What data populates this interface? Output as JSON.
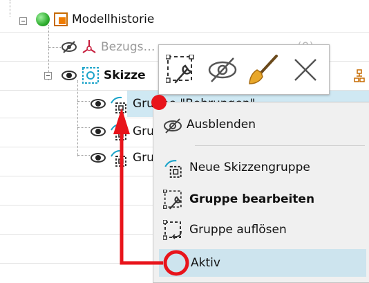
{
  "tree": {
    "root": {
      "label": "Modellhistorie"
    },
    "reference": {
      "label": "Bezugs…",
      "count_text": "(0)"
    },
    "sketch": {
      "label": "Skizze"
    },
    "groups": [
      {
        "label": "Gruppe \"Bohrungen\""
      },
      {
        "label": "Gru"
      },
      {
        "label": "Gru"
      }
    ]
  },
  "mini_toolbar": {
    "buttons": [
      {
        "icon": "edit-group-icon"
      },
      {
        "icon": "hide-icon"
      },
      {
        "icon": "brush-icon"
      },
      {
        "icon": "close-icon"
      }
    ]
  },
  "context_menu": {
    "items": [
      {
        "label": "Ausblenden",
        "icon": "hide-icon",
        "bold": false
      },
      {
        "label": "Neue Skizzengruppe",
        "icon": "new-sketch-group-icon",
        "bold": false
      },
      {
        "label": "Gruppe bearbeiten",
        "icon": "edit-group-icon",
        "bold": true
      },
      {
        "label": "Gruppe auflösen",
        "icon": "dissolve-group-icon",
        "bold": false
      },
      {
        "label": "Aktiv",
        "icon": "",
        "bold": false,
        "highlighted": true
      }
    ]
  },
  "colors": {
    "selection": "#cfe8f3",
    "menu_highlight": "#cde4ee",
    "annotation_red": "#e8141b",
    "green_ball": "#35b835",
    "cyan_icon": "#1aa3c9"
  }
}
